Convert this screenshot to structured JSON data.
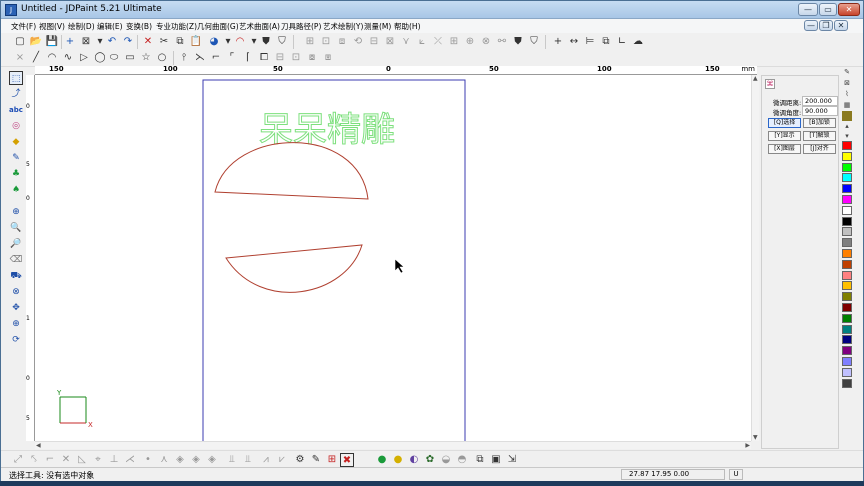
{
  "window": {
    "title": "Untitled - JDPaint 5.21 Ultimate",
    "app_icon": "jdpaint-icon",
    "minimize_label": "—",
    "maximize_label": "▭",
    "close_label": "✕"
  },
  "menu": {
    "items": [
      "文件(F)",
      "视图(V)",
      "绘制(D)",
      "编辑(E)",
      "变换(B)",
      "专业功能(Z)",
      "几何曲面(G)",
      "艺术曲面(A)",
      "刀具路径(P)",
      "艺术绘制(Y)",
      "测量(M)",
      "帮助(H)"
    ],
    "mdi_minimize": "—",
    "mdi_restore": "❐",
    "mdi_close": "✕"
  },
  "ruler": {
    "h_labels": [
      "150",
      "100",
      "50",
      "0",
      "50",
      "100",
      "150"
    ],
    "unit": "mm",
    "v_labels": [
      "0",
      "5",
      "0",
      "1",
      "0",
      "5"
    ]
  },
  "canvas": {
    "art_text": "呆呆精雕",
    "art_text_color": "#7ee07e",
    "shape_color": "#b04030",
    "page_border_color": "#3b3bb0",
    "axis_color": "#1a8a1a",
    "axis_x_color": "#c62828",
    "axis_x_label": "X",
    "axis_y_label": "Y"
  },
  "panel": {
    "tab_icon": "move-icon",
    "fields": [
      {
        "label": "微调距离:",
        "value": "200.000"
      },
      {
        "label": "微调角度:",
        "value": "90.000"
      }
    ],
    "buttons": [
      [
        "[Q]选择",
        "[B]加锁"
      ],
      [
        "[Y]显示",
        "[T]解锁"
      ],
      [
        "[X]图层",
        "[J]对齐"
      ]
    ]
  },
  "palette": {
    "colors": [
      "#ff0000",
      "#ffff00",
      "#00ff00",
      "#00ffff",
      "#0000ff",
      "#ff00ff",
      "#ffffff",
      "#000000",
      "#c0c0c0",
      "#808080",
      "#ff8000",
      "#c04000",
      "#ff8080",
      "#ffc000",
      "#808000",
      "#800000",
      "#008000",
      "#008080",
      "#000080",
      "#800080",
      "#8080ff",
      "#c0c0ff",
      "#404040"
    ]
  },
  "status": {
    "text": "选择工具: 没有选中对象",
    "coords": "27.87  17.95  0.00",
    "unit": "U"
  }
}
